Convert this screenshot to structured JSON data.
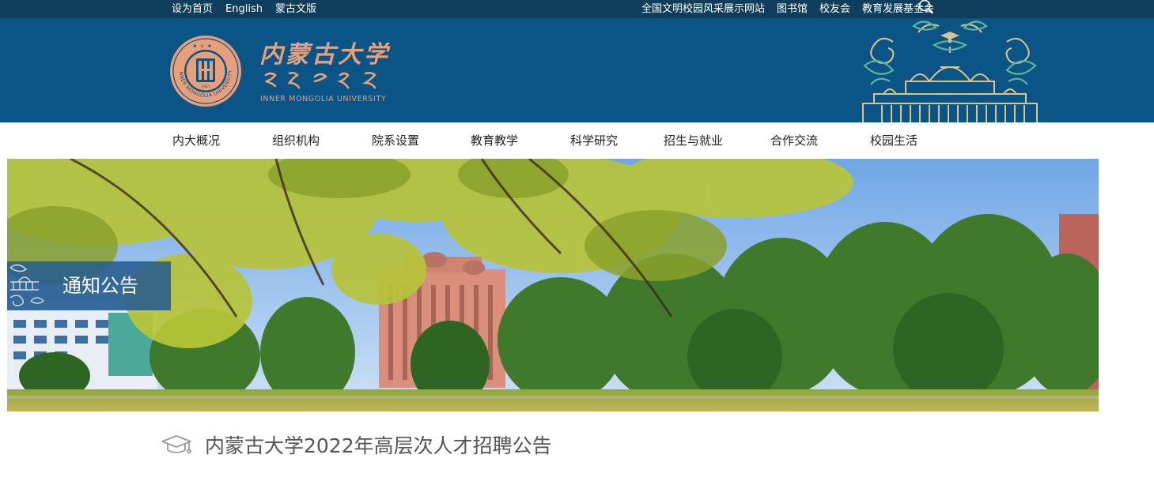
{
  "topbar": {
    "left_links": [
      "设为首页",
      "English",
      "蒙古文版"
    ],
    "right_links": [
      "全国文明校园风采展示网站",
      "图书馆",
      "校友会",
      "教育发展基金会"
    ]
  },
  "logo": {
    "chinese_name": "内蒙古大学",
    "english_name": "INNER MONGOLIA UNIVERSITY",
    "seal_text": "INNER MONGOLIA UNIVERSITY",
    "seal_year": "1957"
  },
  "nav": {
    "items": [
      "内大概况",
      "组织机构",
      "院系设置",
      "教育教学",
      "科学研究",
      "招生与就业",
      "合作交流",
      "校园生活"
    ]
  },
  "banner": {
    "section_label": "通知公告"
  },
  "article": {
    "title": "内蒙古大学2022年高层次人才招聘公告"
  },
  "colors": {
    "topbar_bg": "#0f3d5c",
    "header_bg": "#0a5486",
    "logo_accent": "#e8a07a",
    "tag_bg": "#265c8e"
  },
  "icons": {
    "search": "search-icon",
    "article": "mortarboard-icon"
  }
}
